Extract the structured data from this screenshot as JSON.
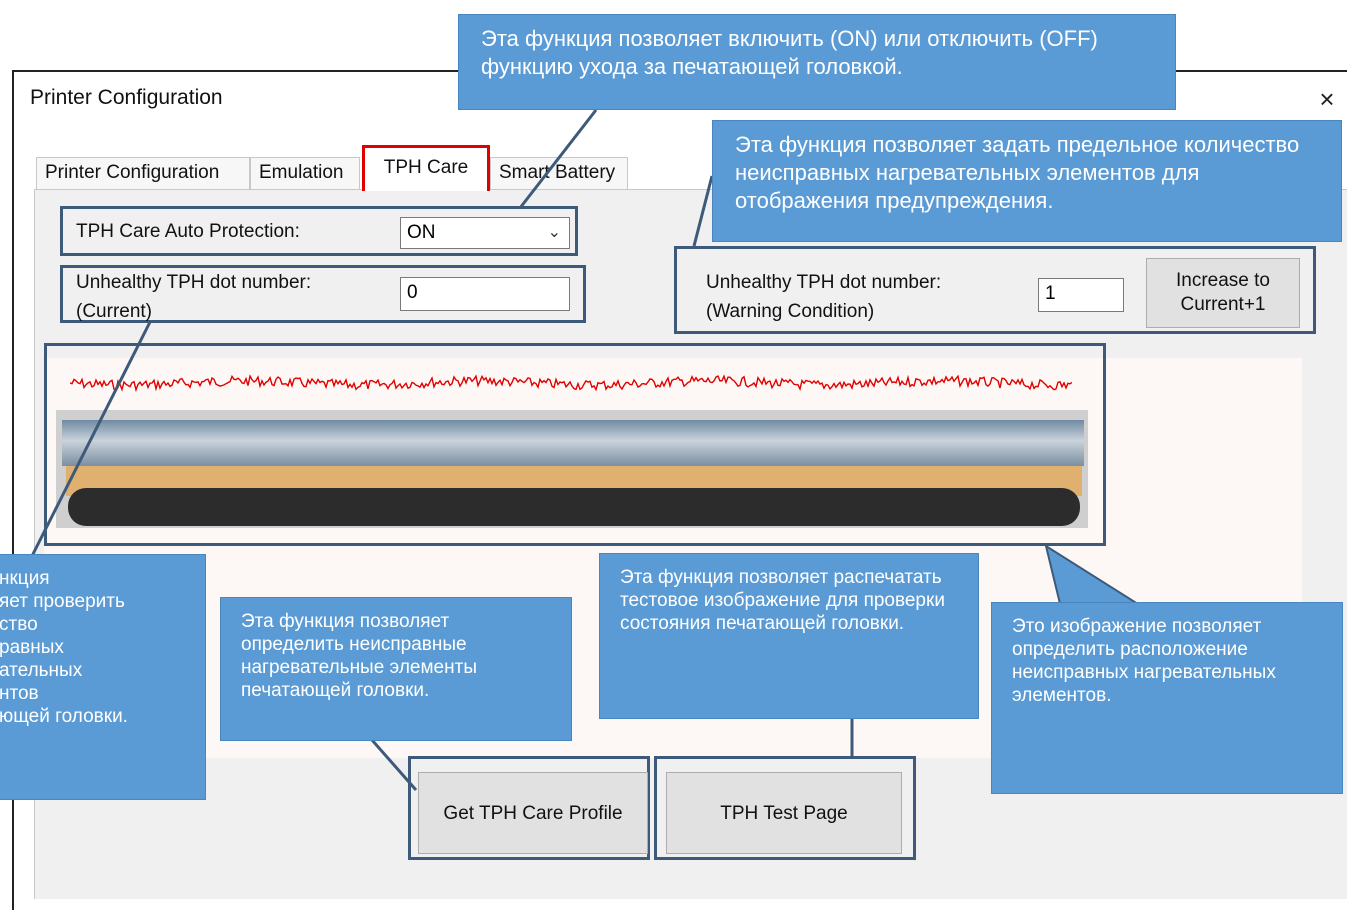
{
  "window": {
    "title": "Printer Configuration",
    "close_glyph": "×"
  },
  "tabs": [
    {
      "label": "Printer Configuration",
      "active": false
    },
    {
      "label": "Emulation",
      "active": false
    },
    {
      "label": "TPH Care",
      "active": true
    },
    {
      "label": "Smart Battery",
      "active": false
    }
  ],
  "form": {
    "auto_protection_label": "TPH Care Auto Protection:",
    "auto_protection_value": "ON",
    "current_label_line1": "Unhealthy TPH dot number:",
    "current_label_line2": "(Current)",
    "current_value": "0",
    "warning_label_line1": "Unhealthy TPH dot number:",
    "warning_label_line2": "(Warning Condition)",
    "warning_value": "1",
    "increase_button_line1": "Increase to",
    "increase_button_line2": "Current+1"
  },
  "buttons": {
    "get_profile": "Get TPH Care Profile",
    "test_page": "TPH Test Page"
  },
  "callouts": {
    "top": "Эта функция позволяет включить (ON) или отключить (OFF) функцию ухода за печатающей головкой.",
    "right_top": "Эта функция позволяет задать предельное количество неисправных нагревательных элементов для отображения предупреждения.",
    "left": "нкция\nяет проверить\nство\nравных\nательных\nнтов\nющей головки.",
    "profile": "Эта функция позволяет определить неисправные нагревательные элементы печатающей головки.",
    "test": "Эта функция позволяет распечатать тестовое изображение для проверки состояния печатающей головки.",
    "image": "Это изображение позволяет определить расположение неисправных нагревательных элементов."
  },
  "colors": {
    "callout_bg": "#5b9bd5",
    "highlight_border": "#3e5a7a",
    "active_tab_border": "#e00000",
    "signal_line": "#e00000"
  }
}
